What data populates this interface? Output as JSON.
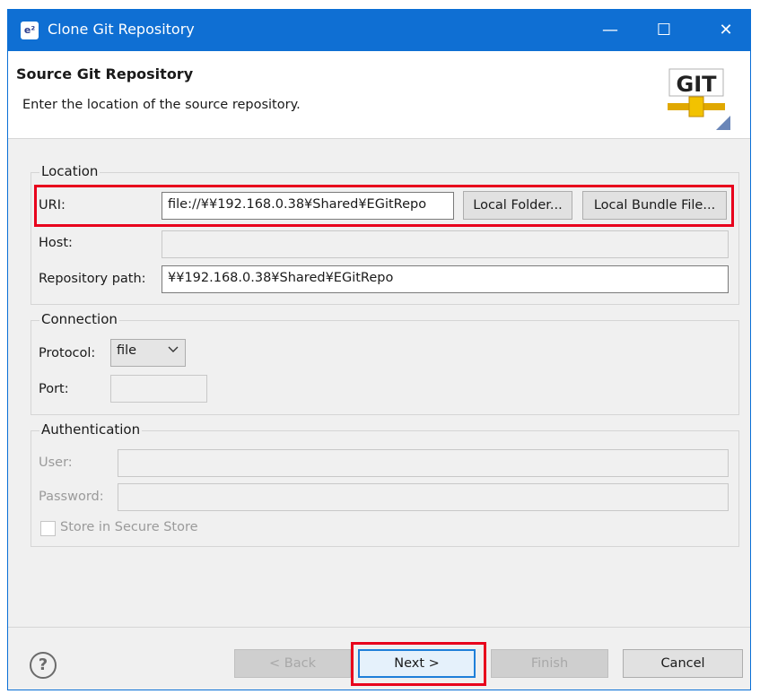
{
  "window": {
    "title": "Clone Git Repository",
    "app_icon": "e²",
    "minimize": "—",
    "maximize": "☐",
    "close": "✕"
  },
  "header": {
    "title": "Source Git Repository",
    "description": "Enter the location of the source repository.",
    "logo_text": "GIT"
  },
  "location": {
    "legend": "Location",
    "uri_label": "URI:",
    "uri_value": "file://¥¥192.168.0.38¥Shared¥EGitRepo",
    "local_folder_button": "Local Folder...",
    "local_bundle_button": "Local Bundle File...",
    "host_label": "Host:",
    "host_value": "",
    "repo_path_label": "Repository path:",
    "repo_path_value": "¥¥192.168.0.38¥Shared¥EGitRepo"
  },
  "connection": {
    "legend": "Connection",
    "protocol_label": "Protocol:",
    "protocol_value": "file",
    "port_label": "Port:",
    "port_value": ""
  },
  "authentication": {
    "legend": "Authentication",
    "user_label": "User:",
    "password_label": "Password:",
    "store_label": "Store in Secure Store"
  },
  "footer": {
    "help": "?",
    "back": "< Back",
    "next": "Next >",
    "finish": "Finish",
    "cancel": "Cancel"
  },
  "colors": {
    "titlebar": "#0f6fd3",
    "highlight": "#e8001c",
    "default_button_border": "#1e7fd9"
  }
}
